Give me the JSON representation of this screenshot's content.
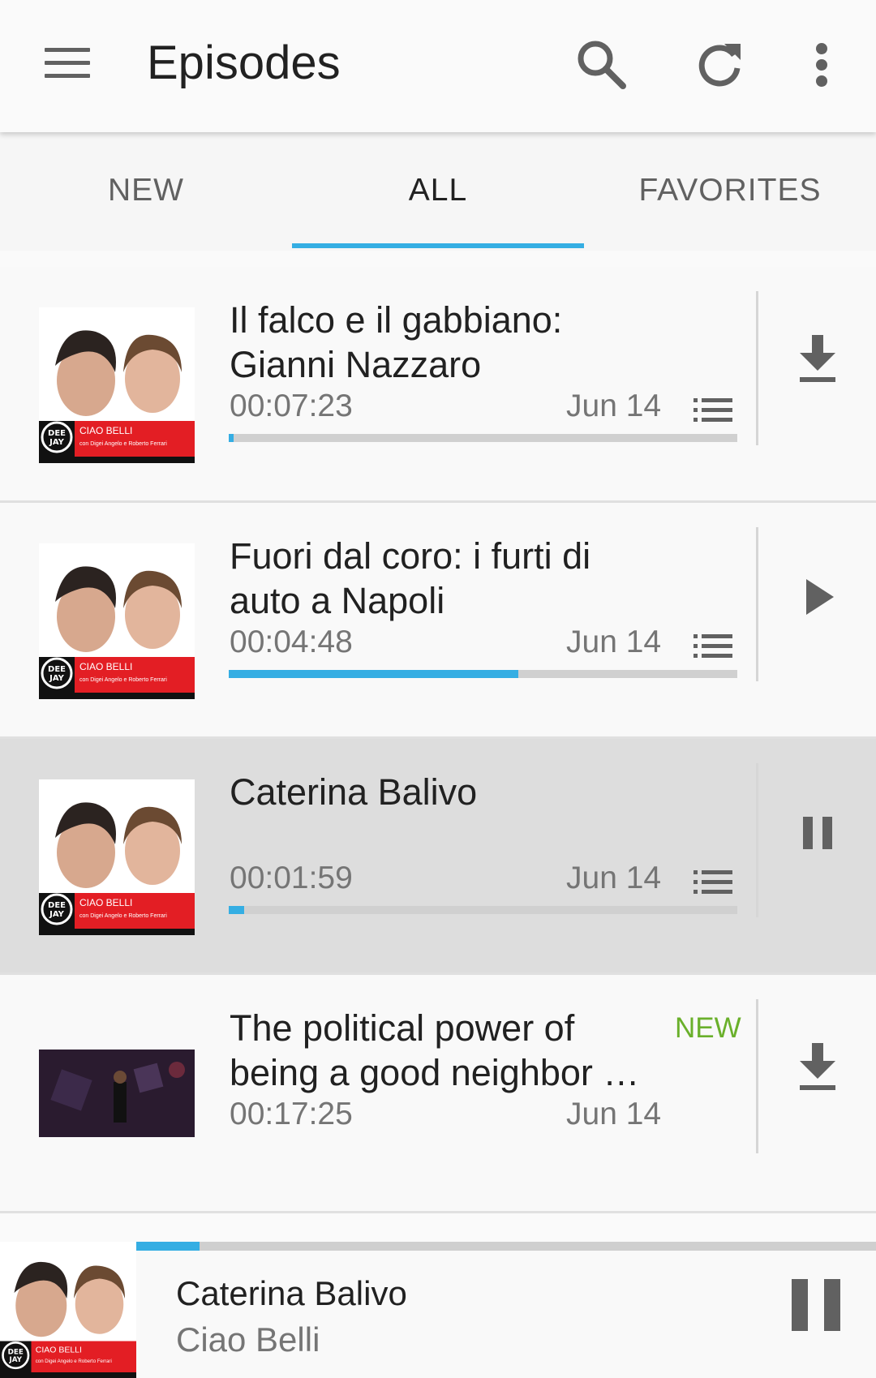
{
  "toolbar": {
    "title": "Episodes",
    "icons": [
      "menu-icon",
      "search-icon",
      "refresh-icon",
      "more-vert-icon"
    ]
  },
  "tabs": [
    {
      "label": "NEW"
    },
    {
      "label": "ALL",
      "active": true
    },
    {
      "label": "FAVORITES"
    }
  ],
  "episodes": [
    {
      "title": "Il falco e il gabbiano: Gianni Nazzaro",
      "duration": "00:07:23",
      "date": "Jun 14",
      "progress": 0.01,
      "action": "download-icon",
      "show_chapters": true
    },
    {
      "title": "Fuori dal coro: i furti di auto a Napoli",
      "duration": "00:04:48",
      "date": "Jun 14",
      "progress": 0.57,
      "action": "play-icon",
      "show_chapters": true
    },
    {
      "title": "Caterina Balivo",
      "duration": "00:01:59",
      "date": "Jun 14",
      "progress": 0.03,
      "action": "pause-icon",
      "show_chapters": true,
      "selected": true
    },
    {
      "title": "The political power of being a good neighbor …",
      "duration": "00:17:25",
      "date": "Jun 14",
      "badge": "NEW",
      "action": "download-icon",
      "show_chapters": false
    }
  ],
  "thumb_text": {
    "logo_top": "DEE",
    "logo_bottom": "JAY",
    "show_name": "CIAO BELLI",
    "show_sub": "con Digei Angelo e Roberto Ferrari"
  },
  "now_playing": {
    "title": "Caterina Balivo",
    "subtitle": "Ciao Belli",
    "progress": 0.085
  },
  "colors": {
    "accent": "#35aee3",
    "new_badge": "#6ab02b",
    "thumb_red": "#e31e24"
  }
}
